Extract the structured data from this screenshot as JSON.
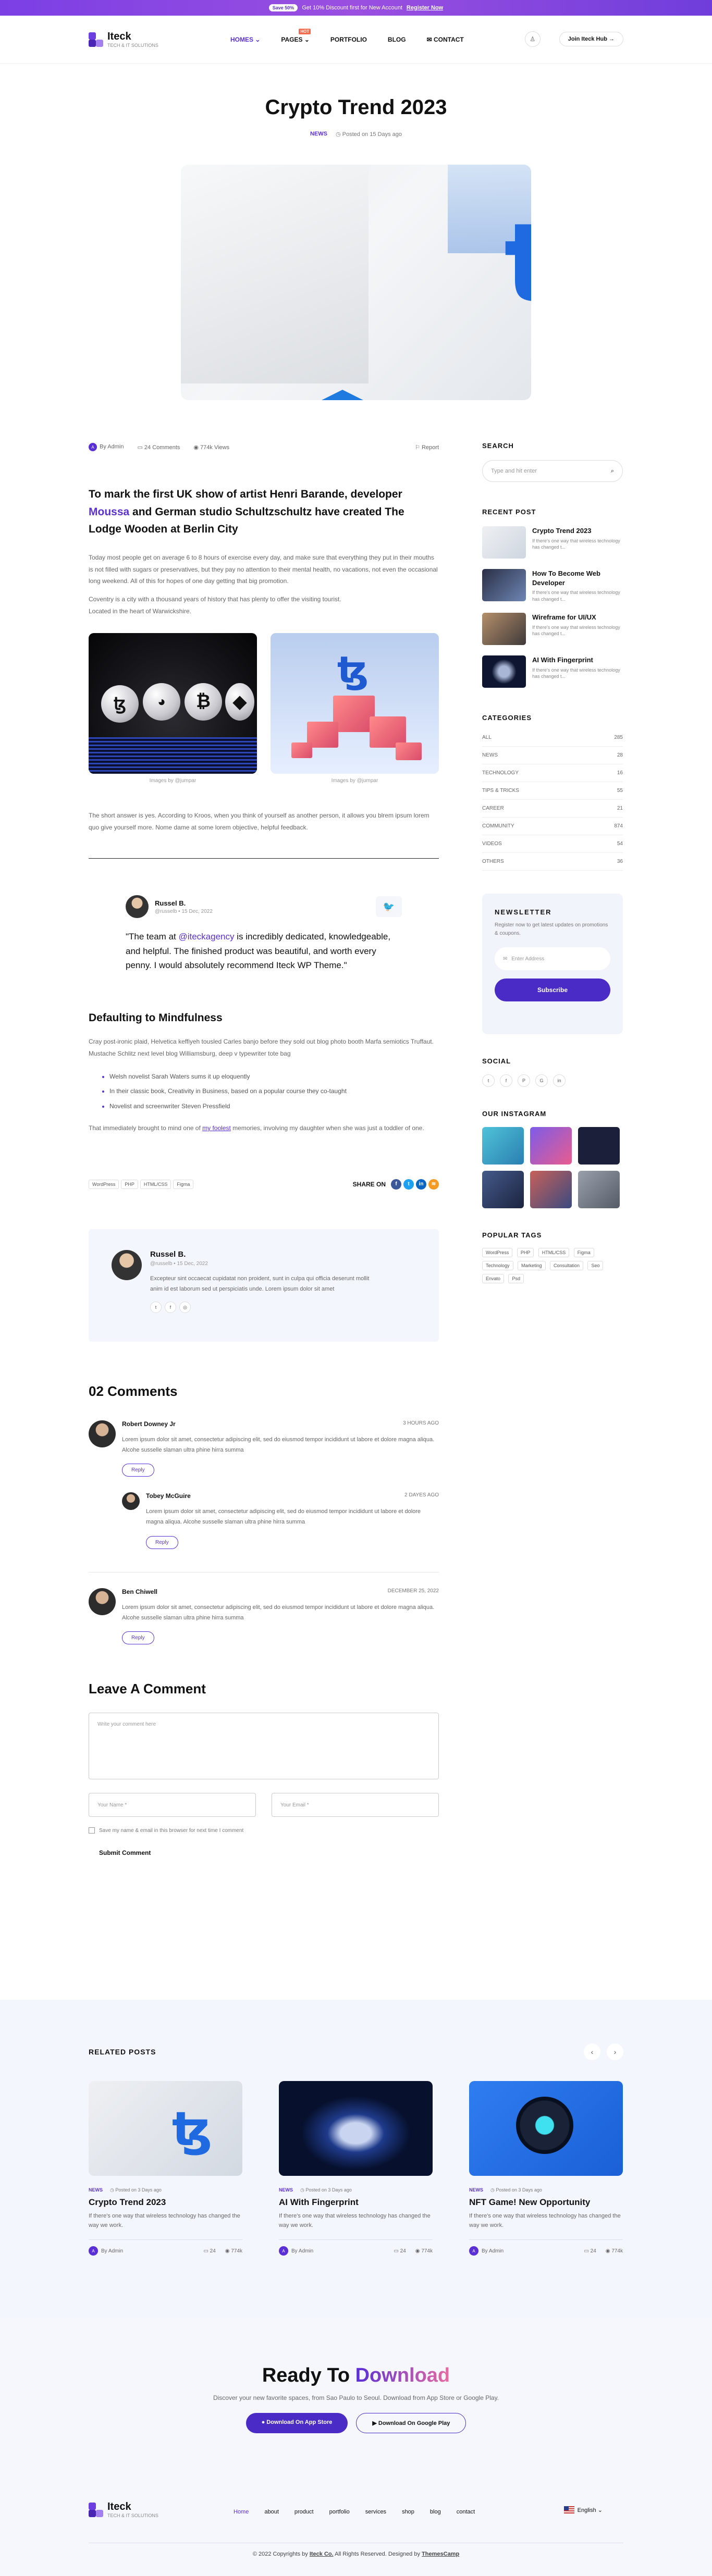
{
  "topbar": {
    "pill": "Save 50%",
    "text": "Get 10% Discount first for New Account",
    "register": "Register Now"
  },
  "brand": {
    "name": "Iteck",
    "tagline": "TECH & IT SOLUTIONS"
  },
  "nav": {
    "items": [
      {
        "label": "HOMES ⌄"
      },
      {
        "label": "PAGES ⌄",
        "badge": "HOT"
      },
      {
        "label": "PORTFOLIO"
      },
      {
        "label": "BLOG"
      },
      {
        "label": "✉ CONTACT"
      }
    ]
  },
  "header": {
    "join": "Join Iteck Hub →",
    "user_icon": "user-icon"
  },
  "post": {
    "title": "Crypto Trend 2023",
    "category": "NEWS",
    "posted": "◷  Posted on 15 Days ago"
  },
  "stats": {
    "author": "By Admin",
    "comments": "24 Comments",
    "views": "774k Views",
    "report": "⚐ Report"
  },
  "lead": {
    "part1": "To mark the first UK show of artist Henri Barande, developer ",
    "highlight": "Moussa",
    "part2": " and German studio Schultzschultz have created The Lodge Wooden at Berlin City"
  },
  "para1": "Today most people get on average 6 to 8 hours of exercise every day, and make sure that everything they put in their mouths is not filled with sugars or preservatives, but they pay no attention to their mental health, no vacations, not even the occasional long weekend. All of this for hopes of one day getting that big promotion.",
  "para2a": "Coventry is a city with a thousand years of history that has plenty to offer the visiting tourist.",
  "para2b": "Located in the heart of Warwickshire.",
  "images": {
    "cap1": "Images by @jumpar",
    "cap2": "Images by @jumpar"
  },
  "para3": "The short answer is yes. According to Kroos, when you think of yourself as another person, it allows you blrem ipsum lorem quo give yourself more. Nome dame at some lorem objective, helpful feedback.",
  "quote": {
    "name": "Russel B.",
    "handle": "@russelb • 15 Dec, 2022",
    "pre": "\"The team at ",
    "mention": "@iteckagency",
    "post": " is incredibly dedicated, knowledgeable, and helpful. The finished product was beautiful, and worth every penny. I would absolutely recommend Iteck WP Theme.\""
  },
  "section": {
    "title": "Defaulting to Mindfulness",
    "para": "Cray post-ironic plaid, Helvetica keffiyeh tousled Carles banjo before they sold out blog photo booth Marfa semiotics Truffaut. Mustache Schlitz next level blog Williamsburg, deep v typewriter tote bag",
    "bullets": [
      "Welsh novelist Sarah Waters sums it up eloquently",
      "In their classic book, Creativity in Business, based on a popular course they co-taught",
      "Novelist and screenwriter Steven Pressfield"
    ],
    "para2_pre": "That immediately brought to mind one of ",
    "para2_link": "my foolest",
    "para2_post": " memories, involving my daughter when she was just a toddler of one."
  },
  "tags": [
    "WordPress",
    "PHP",
    "HTML/CSS",
    "Figma"
  ],
  "share": {
    "label": "SHARE ON"
  },
  "author_box": {
    "name": "Russel B.",
    "handle": "@russelb • 15 Dec, 2022",
    "text": "Excepteur sint occaecat cupidatat non proident, sunt in culpa qui officia deserunt mollit anim id est laborum sed ut perspiciatis unde. Lorem ipsum dolor sit amet"
  },
  "comments": {
    "title": "02 Comments",
    "items": [
      {
        "name": "Robert Downey Jr",
        "date": "3 HOURS AGO",
        "text": "Lorem ipsum dolor sit amet, consectetur adipiscing elit, sed do eiusmod tempor incididunt ut labore et dolore magna aliqua. Alcohe susselle slaman ultra phine hirra summa",
        "reply": "Reply"
      },
      {
        "name": "Tobey McGuire",
        "date": "2 DAYES AGO",
        "text": "Lorem ipsum dolor sit amet, consectetur adipiscing elit, sed do eiusmod tempor incididunt ut labore et dolore magna aliqua. Alcohe susselle slaman ultra phine hirra summa",
        "reply": "Reply"
      },
      {
        "name": "Ben Chiwell",
        "date": "DECEMBER 25, 2022",
        "text": "Lorem ipsum dolor sit amet, consectetur adipiscing elit, sed do eiusmod tempor incididunt ut labore et dolore magna aliqua. Alcohe susselle slaman ultra phine hirra summa",
        "reply": "Reply"
      }
    ]
  },
  "form": {
    "title": "Leave A Comment",
    "comment_ph": "Write your comment here",
    "name_ph": "Your Name *",
    "email_ph": "Your Email *",
    "save": "Save my name & email in this browser for next time I comment",
    "submit": "Submit Comment"
  },
  "sidebar": {
    "search_title": "SEARCH",
    "search_ph": "Type and hit enter",
    "recent_title": "RECENT POST",
    "recent": [
      {
        "title": "Crypto Trend 2023",
        "desc": "If there's one way that wireless technology has changed t..."
      },
      {
        "title": "How To Become Web Developer",
        "desc": "If there's one way that wireless technology has changed t..."
      },
      {
        "title": "Wireframe for UI/UX",
        "desc": "If there's one way that wireless technology has changed t..."
      },
      {
        "title": "AI With Fingerprint",
        "desc": "If there's one way that wireless technology has changed t..."
      }
    ],
    "cat_title": "CATEGORIES",
    "categories": [
      {
        "name": "ALL",
        "count": "285"
      },
      {
        "name": "NEWS",
        "count": "28"
      },
      {
        "name": "TECHNOLOGY",
        "count": "16"
      },
      {
        "name": "TIPS & TRICKS",
        "count": "55"
      },
      {
        "name": "CAREER",
        "count": "21"
      },
      {
        "name": "COMMUNITY",
        "count": "874"
      },
      {
        "name": "VIDEOS",
        "count": "54"
      },
      {
        "name": "OTHERS",
        "count": "36"
      }
    ],
    "nl": {
      "title": "NEWSLETTER",
      "desc": "Register now to get latest updates on promotions & coupons.",
      "email_ph": "Enter Address",
      "btn": "Subscribe"
    },
    "social_title": "SOCIAL",
    "social": [
      "t",
      "f",
      "P",
      "G",
      "in"
    ],
    "ig_title": "OUR INSTAGRAM",
    "ptags_title": "POPULAR TAGS",
    "ptags": [
      "WordPress",
      "PHP",
      "HTML/CSS",
      "Figma",
      "Technology",
      "Marketing",
      "Consultation",
      "Seo",
      "Envato",
      "Psd"
    ]
  },
  "related": {
    "title": "RELATED POSTS",
    "items": [
      {
        "cat": "NEWS",
        "date": "◷ Posted on 3 Days ago",
        "title": "Crypto Trend 2023",
        "desc": "If there's one way that wireless technology has changed the way we work.",
        "by": "By Admin",
        "comments": "24",
        "views": "774k"
      },
      {
        "cat": "NEWS",
        "date": "◷ Posted on 3 Days ago",
        "title": "AI With Fingerprint",
        "desc": "If there's one way that wireless technology has changed the way we work.",
        "by": "By Admin",
        "comments": "24",
        "views": "774k"
      },
      {
        "cat": "NEWS",
        "date": "◷ Posted on 3 Days ago",
        "title": "NFT Game! New Opportunity",
        "desc": "If there's one way that wireless technology has changed the way we work.",
        "by": "By Admin",
        "comments": "24",
        "views": "774k"
      }
    ]
  },
  "cta": {
    "title1": "Ready To ",
    "title2": "Download",
    "desc": "Discover your new favorite spaces, from Sao Paulo to Seoul. Download from App Store or Google Play.",
    "app": "Download On App Store",
    "google": "Download On Google Play"
  },
  "footer": {
    "nav": [
      "Home",
      "about",
      "product",
      "portfolio",
      "services",
      "shop",
      "blog",
      "contact"
    ],
    "lang": "English ⌄",
    "copy_pre": "© 2022 Copyrights by ",
    "copy_brand": "Iteck Co.",
    "copy_mid": " All Rights Reserved. Designed by ",
    "copy_designer": "ThemesCamp"
  }
}
